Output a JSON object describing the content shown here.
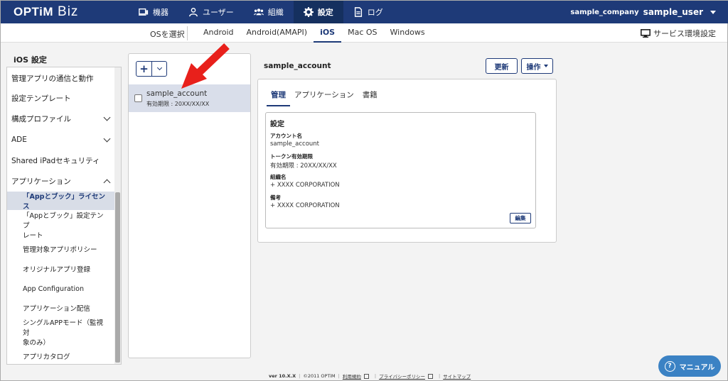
{
  "header": {
    "logo": "OPTiM",
    "logo_suffix": "Biz",
    "nav": [
      {
        "label": "機器",
        "icon": "device-icon"
      },
      {
        "label": "ユーザー",
        "icon": "user-icon"
      },
      {
        "label": "組織",
        "icon": "group-icon"
      },
      {
        "label": "設定",
        "icon": "gear-icon"
      },
      {
        "label": "ログ",
        "icon": "log-icon"
      }
    ],
    "company": "sample_company",
    "user": "sample_user"
  },
  "osbar": {
    "select_label": "OSを選択",
    "tabs": [
      "Android",
      "Android(AMAPI)",
      "iOS",
      "Mac OS",
      "Windows"
    ],
    "active_tab": "iOS",
    "env_setting": "サービス環境設定"
  },
  "sidebar": {
    "title": "iOS 設定",
    "items": [
      "管理アプリの通信と動作",
      "設定テンプレート",
      "構成プロファイル",
      "ADE",
      "Shared iPadセキュリティ",
      "アプリケーション",
      "「Appとブック」ライセンス",
      "「Appとブック」設定テンプレート",
      "管理対象アプリポリシー",
      "オリジナルアプリ登録",
      "App Configuration",
      "アプリケーション配信",
      "シングルAPPモード（監視対象のみ）",
      "アプリカタログ"
    ],
    "sub_line1_7": "「Appとブック」設定テンプ",
    "sub_line2_7": "レート",
    "sub_line1_12": "シングルAPPモード（監視対",
    "sub_line2_12": "象のみ）"
  },
  "list": {
    "items": [
      {
        "name": "sample_account",
        "expiry": "有効期限 : 20XX/XX/XX"
      }
    ]
  },
  "detail": {
    "title": "sample_account",
    "refresh_label": "更新",
    "operation_label": "操作",
    "tabs": [
      "管理",
      "アプリケーション",
      "書籍"
    ],
    "section_title": "設定",
    "fields": [
      {
        "label": "アカウント名",
        "value": "sample_account"
      },
      {
        "label": "トークン有効期限",
        "value": "有効期限 : 20XX/XX/XX"
      },
      {
        "label": "組織名",
        "value": "+ XXXX CORPORATION"
      },
      {
        "label": "備考",
        "value": "+ XXXX CORPORATION"
      }
    ],
    "edit_label": "編集"
  },
  "footer": {
    "version": "ver 10.X.X",
    "copyright": "©2011 OPTiM",
    "terms": "利用規約",
    "privacy": "プライバシーポリシー",
    "sitemap": "サイトマップ"
  },
  "manual_label": "マニュアル",
  "colors": {
    "nav_bg": "#1e3a78",
    "accent": "#1e3a78",
    "manual_bg": "#3b82c4",
    "arrow": "#e8201b"
  }
}
